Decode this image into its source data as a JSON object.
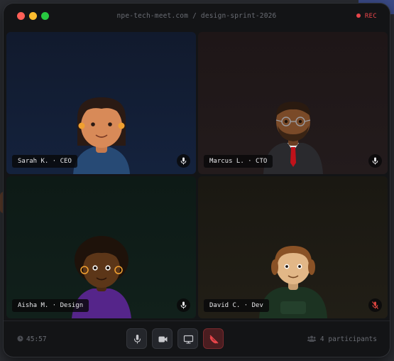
{
  "window": {
    "title": "npe-tech-meet.com / design-sprint-2026",
    "recording_label": "REC"
  },
  "participants": [
    {
      "name_tag": "Sarah K. · CEO",
      "muted": false
    },
    {
      "name_tag": "Marcus L. · CTO",
      "muted": false
    },
    {
      "name_tag": "Aisha M. · Design",
      "muted": false
    },
    {
      "name_tag": "David C. · Dev",
      "muted": true
    }
  ],
  "controls": {
    "timer": "45:57",
    "participant_count": "4 participants",
    "buttons": [
      "microphone",
      "camera",
      "screen-share",
      "end-call"
    ]
  },
  "colors": {
    "recording": "#e8454a",
    "end_call": "#e8454a",
    "muted_mic": "#d9443f"
  }
}
